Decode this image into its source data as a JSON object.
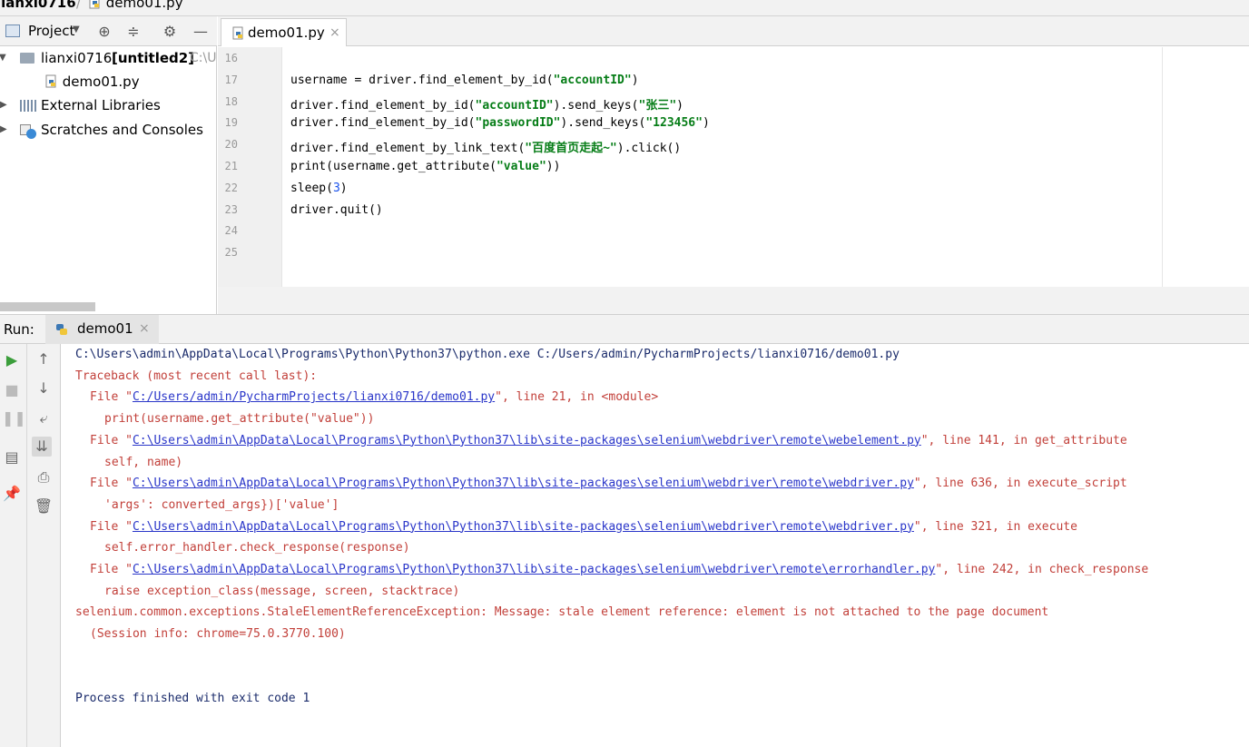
{
  "breadcrumb": {
    "project": "lianxi0716",
    "separator": "/",
    "file": "demo01.py"
  },
  "project_panel": {
    "title": "Project",
    "tree": {
      "root_label": "lianxi0716",
      "root_module": "[untitled2]",
      "root_path": "C:\\U",
      "file": "demo01.py",
      "external_libraries": "External Libraries",
      "scratches": "Scratches and Consoles"
    }
  },
  "editor": {
    "tab_label": "demo01.py",
    "tab_close": "×",
    "line_numbers": [
      "16",
      "17",
      "18",
      "19",
      "20",
      "21",
      "22",
      "23",
      "24",
      "25"
    ],
    "lines": [
      {
        "parts": []
      },
      {
        "parts": [
          {
            "t": "username = driver.find_element_by_id(",
            "c": ""
          },
          {
            "t": "\"accountID\"",
            "c": "str"
          },
          {
            "t": ")",
            "c": ""
          }
        ]
      },
      {
        "parts": [
          {
            "t": "driver.find_element_by_id(",
            "c": ""
          },
          {
            "t": "\"accountID\"",
            "c": "str"
          },
          {
            "t": ").send_keys(",
            "c": ""
          },
          {
            "t": "\"张三\"",
            "c": "str"
          },
          {
            "t": ")",
            "c": ""
          }
        ]
      },
      {
        "parts": [
          {
            "t": "driver.find_element_by_id(",
            "c": ""
          },
          {
            "t": "\"passwordID\"",
            "c": "str"
          },
          {
            "t": ").send_keys(",
            "c": ""
          },
          {
            "t": "\"123456\"",
            "c": "str"
          },
          {
            "t": ")",
            "c": ""
          }
        ]
      },
      {
        "parts": [
          {
            "t": "driver.find_element_by_link_text(",
            "c": ""
          },
          {
            "t": "\"百度首页走起~\"",
            "c": "str"
          },
          {
            "t": ").click()",
            "c": ""
          }
        ]
      },
      {
        "parts": [
          {
            "t": "print(username.get_attribute(",
            "c": ""
          },
          {
            "t": "\"value\"",
            "c": "str"
          },
          {
            "t": "))",
            "c": ""
          }
        ]
      },
      {
        "parts": [
          {
            "t": "sleep(",
            "c": ""
          },
          {
            "t": "3",
            "c": "num"
          },
          {
            "t": ")",
            "c": ""
          }
        ]
      },
      {
        "parts": [
          {
            "t": "driver.quit()",
            "c": ""
          }
        ]
      },
      {
        "parts": []
      },
      {
        "parts": []
      }
    ]
  },
  "run": {
    "label": "Run:",
    "tab_label": "demo01",
    "tab_close": "×"
  },
  "console": {
    "lines": [
      {
        "indent": 0,
        "parts": [
          {
            "t": "C:\\Users\\admin\\AppData\\Local\\Programs\\Python\\Python37\\python.exe C:/Users/admin/PycharmProjects/lianxi0716/demo01.py",
            "c": "cmd"
          }
        ]
      },
      {
        "indent": 0,
        "parts": [
          {
            "t": "Traceback (most recent call last):",
            "c": "err"
          }
        ]
      },
      {
        "indent": 2,
        "parts": [
          {
            "t": "File \"",
            "c": "err"
          },
          {
            "t": "C:/Users/admin/PycharmProjects/lianxi0716/demo01.py",
            "c": "link"
          },
          {
            "t": "\", line 21, in <module>",
            "c": "err"
          }
        ]
      },
      {
        "indent": 4,
        "parts": [
          {
            "t": "print(username.get_attribute(\"value\"))",
            "c": "err"
          }
        ]
      },
      {
        "indent": 2,
        "parts": [
          {
            "t": "File \"",
            "c": "err"
          },
          {
            "t": "C:\\Users\\admin\\AppData\\Local\\Programs\\Python\\Python37\\lib\\site-packages\\selenium\\webdriver\\remote\\webelement.py",
            "c": "link"
          },
          {
            "t": "\", line 141, in get_attribute",
            "c": "err"
          }
        ]
      },
      {
        "indent": 4,
        "parts": [
          {
            "t": "self, name)",
            "c": "err"
          }
        ]
      },
      {
        "indent": 2,
        "parts": [
          {
            "t": "File \"",
            "c": "err"
          },
          {
            "t": "C:\\Users\\admin\\AppData\\Local\\Programs\\Python\\Python37\\lib\\site-packages\\selenium\\webdriver\\remote\\webdriver.py",
            "c": "link"
          },
          {
            "t": "\", line 636, in execute_script",
            "c": "err"
          }
        ]
      },
      {
        "indent": 4,
        "parts": [
          {
            "t": "'args': converted_args})['value']",
            "c": "err"
          }
        ]
      },
      {
        "indent": 2,
        "parts": [
          {
            "t": "File \"",
            "c": "err"
          },
          {
            "t": "C:\\Users\\admin\\AppData\\Local\\Programs\\Python\\Python37\\lib\\site-packages\\selenium\\webdriver\\remote\\webdriver.py",
            "c": "link"
          },
          {
            "t": "\", line 321, in execute",
            "c": "err"
          }
        ]
      },
      {
        "indent": 4,
        "parts": [
          {
            "t": "self.error_handler.check_response(response)",
            "c": "err"
          }
        ]
      },
      {
        "indent": 2,
        "parts": [
          {
            "t": "File \"",
            "c": "err"
          },
          {
            "t": "C:\\Users\\admin\\AppData\\Local\\Programs\\Python\\Python37\\lib\\site-packages\\selenium\\webdriver\\remote\\errorhandler.py",
            "c": "link"
          },
          {
            "t": "\", line 242, in check_response",
            "c": "err"
          }
        ]
      },
      {
        "indent": 4,
        "parts": [
          {
            "t": "raise exception_class(message, screen, stacktrace)",
            "c": "err"
          }
        ]
      },
      {
        "indent": 0,
        "parts": [
          {
            "t": "selenium.common.exceptions.StaleElementReferenceException: Message: stale element reference: element is not attached to the page document",
            "c": "err"
          }
        ]
      },
      {
        "indent": 2,
        "parts": [
          {
            "t": "(Session info: chrome=75.0.3770.100)",
            "c": "err"
          }
        ]
      },
      {
        "indent": 0,
        "parts": []
      },
      {
        "indent": 0,
        "parts": []
      },
      {
        "indent": 0,
        "parts": [
          {
            "t": "Process finished with exit code 1",
            "c": "done"
          }
        ]
      }
    ]
  },
  "colors": {
    "string": "#067d17",
    "number": "#1750eb",
    "error": "#c2403a",
    "link": "#2a36c9",
    "command": "#1a2b6b",
    "current_line": "#fffae3"
  }
}
